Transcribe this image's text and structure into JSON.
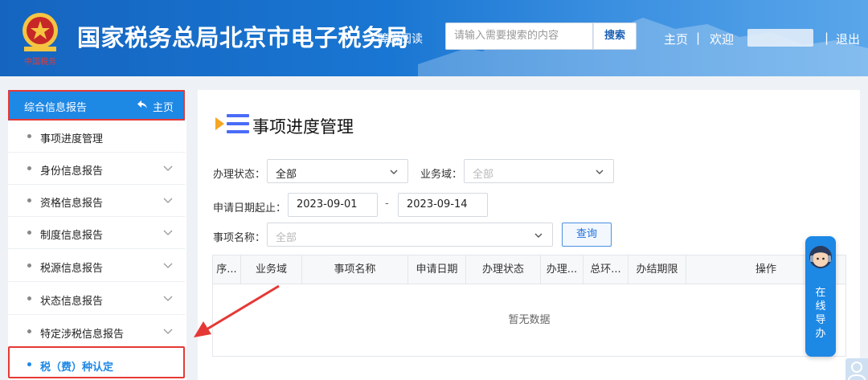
{
  "header": {
    "title": "国家税务总局北京市电子税务局",
    "emblem_caption": "中国税务",
    "barrier_free": "障碍阅读",
    "search_placeholder": "请输入需要搜索的内容",
    "search_button": "搜索",
    "nav_home": "主页",
    "sep": "|",
    "nav_welcome": "欢迎",
    "nav_logout": "退出"
  },
  "sidebar": {
    "header_title": "综合信息报告",
    "header_home": "主页",
    "items": [
      {
        "label": "事项进度管理",
        "has_chevron": false
      },
      {
        "label": "身份信息报告",
        "has_chevron": true
      },
      {
        "label": "资格信息报告",
        "has_chevron": true
      },
      {
        "label": "制度信息报告",
        "has_chevron": true
      },
      {
        "label": "税源信息报告",
        "has_chevron": true
      },
      {
        "label": "状态信息报告",
        "has_chevron": true
      },
      {
        "label": "特定涉税信息报告",
        "has_chevron": true
      },
      {
        "label": "税（费）种认定",
        "has_chevron": false,
        "active": true
      }
    ]
  },
  "main": {
    "title": "事项进度管理",
    "filters": {
      "status_label": "办理状态：",
      "status_value": "全部",
      "domain_label": "业务域：",
      "domain_value": "全部",
      "date_label": "申请日期起止：",
      "date_from": "2023-09-01",
      "date_sep": "-",
      "date_to": "2023-09-14",
      "item_label": "事项名称：",
      "item_value": "全部",
      "query_button": "查询"
    },
    "table": {
      "columns": [
        "序...",
        "业务域",
        "事项名称",
        "申请日期",
        "办理状态",
        "办理...",
        "总环...",
        "办结期限",
        "操作"
      ],
      "empty_text": "暂无数据"
    }
  },
  "guide": {
    "chars": [
      "在",
      "线",
      "导",
      "办"
    ]
  },
  "colors": {
    "header_blue": "#1976d2",
    "accent": "#1e88e5",
    "highlight_red": "#e53935"
  }
}
